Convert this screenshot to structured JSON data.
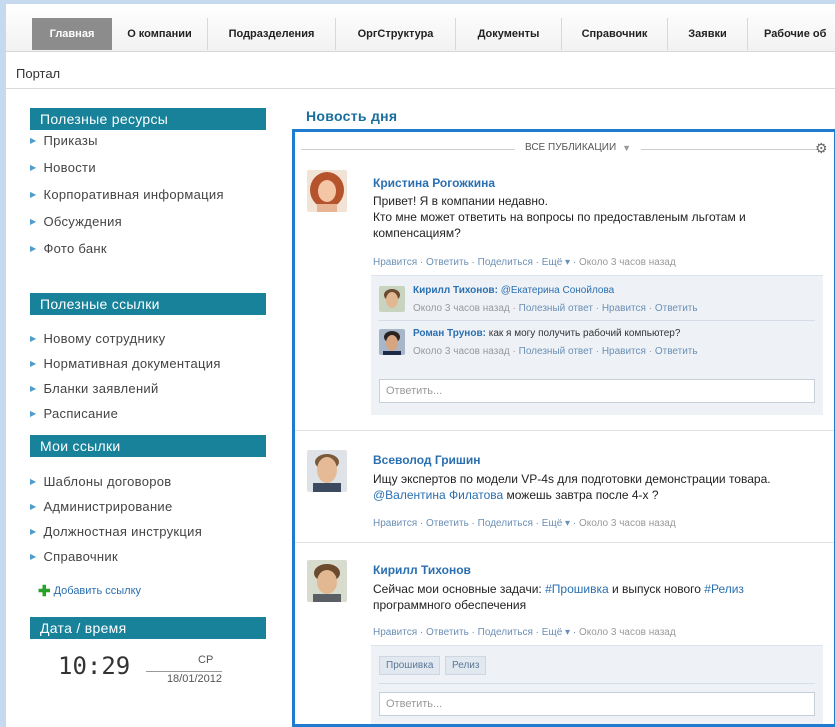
{
  "nav": {
    "tabs": [
      {
        "label": "Главная"
      },
      {
        "label": "О компании"
      },
      {
        "label": "Подразделения"
      },
      {
        "label": "ОргСтруктура"
      },
      {
        "label": "Документы"
      },
      {
        "label": "Справочник"
      },
      {
        "label": "Заявки"
      },
      {
        "label": "Рабочие об"
      }
    ],
    "active_index": 0
  },
  "breadcrumb": "Портал",
  "sidebar": {
    "resources": {
      "title": "Полезные ресурсы",
      "items": [
        "Приказы",
        "Новости",
        "Корпоративная информация",
        "Обсуждения",
        "Фото банк"
      ]
    },
    "links": {
      "title": "Полезные ссылки",
      "items": [
        "Новому сотруднику",
        "Нормативная документация",
        "Бланки заявлений",
        "Расписание"
      ]
    },
    "my_links": {
      "title": "Мои ссылки",
      "items": [
        "Шаблоны договоров",
        "Администрирование",
        "Должностная инструкция",
        "Справочник"
      ],
      "add_label": "Добавить ссылку"
    },
    "datetime": {
      "title": "Дата / время",
      "time": "10:29",
      "day": "СР",
      "date": "18/01/2012"
    }
  },
  "main": {
    "title": "Новость дня",
    "filter_label": "ВСЕ ПУБЛИКАЦИИ",
    "reply_placeholder": "Ответить...",
    "posts": [
      {
        "author": "Кристина Рогожкина",
        "lines": [
          "Привет! Я в компании недавно.",
          "Кто мне может ответить на вопросы по предоставленым льготам и",
          "компенсациям?"
        ],
        "actions": {
          "like": "Нравится",
          "reply": "Ответить",
          "share": "Поделиться",
          "more": "Ещё",
          "time": "Около 3 часов назад"
        },
        "comments": [
          {
            "author": "Кирилл Тихонов:",
            "text": "@Екатерина Сонойлова",
            "time": "Около 3 часов назад",
            "useful": "Полезный ответ",
            "like": "Нравится",
            "reply": "Ответить"
          },
          {
            "author": "Роман Трунов:",
            "text": "как я могу получить рабочий компьютер?",
            "time": "Около 3 часов назад",
            "useful": "Полезный ответ",
            "like": "Нравится",
            "reply": "Ответить"
          }
        ]
      },
      {
        "author": "Всеволод Гришин",
        "line1": "Ищу экспертов по модели VP-4s для подготовки демонстрации товара.",
        "line2_mention": "@Валентина Филатова",
        "line2_rest": " можешь завтра после 4-х ?",
        "actions": {
          "like": "Нравится",
          "reply": "Ответить",
          "share": "Поделиться",
          "more": "Ещё",
          "time": "Около 3 часов назад"
        }
      },
      {
        "author": "Кирилл Тихонов",
        "line1_a": "Сейчас мои основные задачи: ",
        "tag1": "#Прошивка",
        "line1_b": " и выпуск нового ",
        "tag2": "#Релиз",
        "line2": "программного обеспечения",
        "actions": {
          "like": "Нравится",
          "reply": "Ответить",
          "share": "Поделиться",
          "more": "Ещё",
          "time": "Около 3 часов назад"
        },
        "tags": [
          "Прошивка",
          "Релиз"
        ]
      }
    ]
  },
  "colors": {
    "accent": "#17829a",
    "link": "#2a6fb0",
    "feed_border": "#1f7bd0",
    "active_tab": "#8c8c8c"
  }
}
